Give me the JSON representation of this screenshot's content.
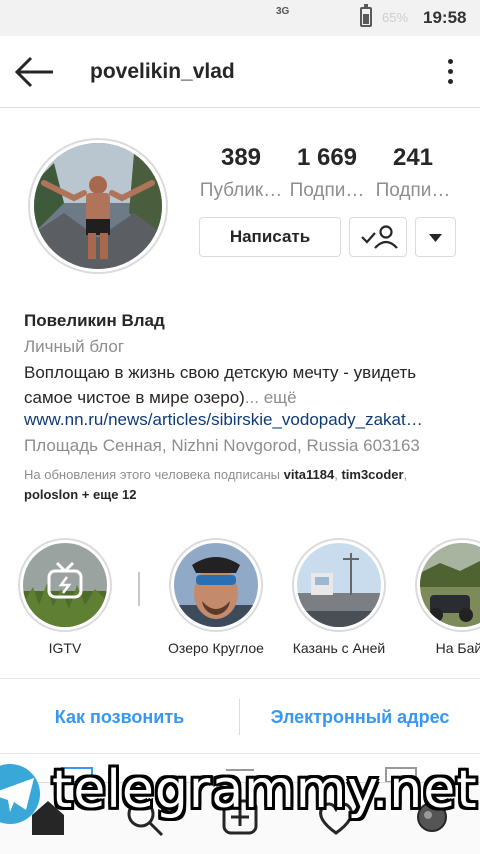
{
  "status_bar": {
    "network": "3G",
    "battery": "65%",
    "time": "19:58"
  },
  "header": {
    "username": "povelikin_vlad"
  },
  "stats": [
    {
      "value": "389",
      "label": "Публик…"
    },
    {
      "value": "1 669",
      "label": "Подпи…"
    },
    {
      "value": "241",
      "label": "Подпи…"
    }
  ],
  "buttons": {
    "message": "Написать"
  },
  "bio": {
    "name": "Повеликин Влад",
    "category": "Личный блог",
    "text": "Воплощаю в жизнь свою детскую мечту - увидеть самое чистое в мире озеро)",
    "more": "... ещё",
    "link": "www.nn.ru/news/articles/sibirskie_vodopady_zakat…",
    "location": "Площадь Сенная, Nizhni Novgorod, Russia 603163",
    "followed_prefix": "На обновления этого человека подписаны",
    "followers": [
      "vita1184",
      "tim3coder",
      "poloslon"
    ],
    "followed_more": "+ еще 12"
  },
  "highlights": [
    {
      "label": "IGTV"
    },
    {
      "label": "Озеро Круглое"
    },
    {
      "label": "Казань с Аней"
    },
    {
      "label": "На Байк"
    }
  ],
  "contact": {
    "call": "Как позвонить",
    "email": "Электронный адрес"
  },
  "watermark": "telegrammy.net",
  "colors": {
    "link": "#0e3b78",
    "accent": "#3897f0",
    "muted": "#8e8e8e",
    "text": "#262626"
  }
}
